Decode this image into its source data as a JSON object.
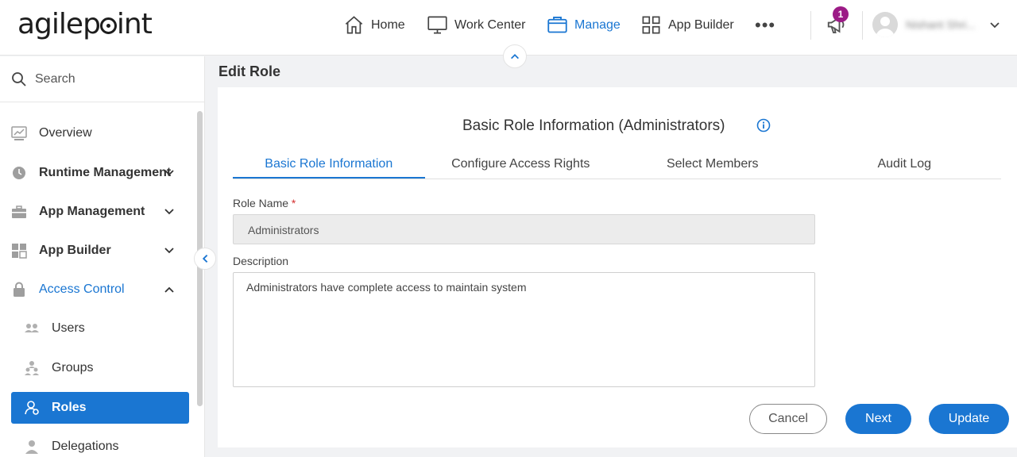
{
  "header": {
    "logo": "agilepoint",
    "nav": [
      {
        "label": "Home"
      },
      {
        "label": "Work Center"
      },
      {
        "label": "Manage"
      },
      {
        "label": "App Builder"
      }
    ],
    "more": "•••",
    "notification_count": "1",
    "username": "Nishant Shri..."
  },
  "sidebar": {
    "search_label": "Search",
    "items": [
      {
        "label": "Overview"
      },
      {
        "label": "Runtime Management"
      },
      {
        "label": "App Management"
      },
      {
        "label": "App Builder"
      },
      {
        "label": "Access Control"
      },
      {
        "label": "Users"
      },
      {
        "label": "Groups"
      },
      {
        "label": "Roles"
      },
      {
        "label": "Delegations"
      }
    ]
  },
  "page": {
    "title": "Edit Role",
    "card_title": "Basic Role Information (Administrators)",
    "tabs": [
      {
        "label": "Basic Role Information"
      },
      {
        "label": "Configure Access Rights"
      },
      {
        "label": "Select Members"
      },
      {
        "label": "Audit Log"
      }
    ],
    "role_name_label": "Role Name",
    "required_mark": "*",
    "role_name_value": "Administrators",
    "description_label": "Description",
    "description_value": "Administrators have complete access to maintain system",
    "buttons": {
      "cancel": "Cancel",
      "next": "Next",
      "update": "Update"
    }
  },
  "colors": {
    "accent": "#1a76d2",
    "badge": "#9c1b86"
  }
}
